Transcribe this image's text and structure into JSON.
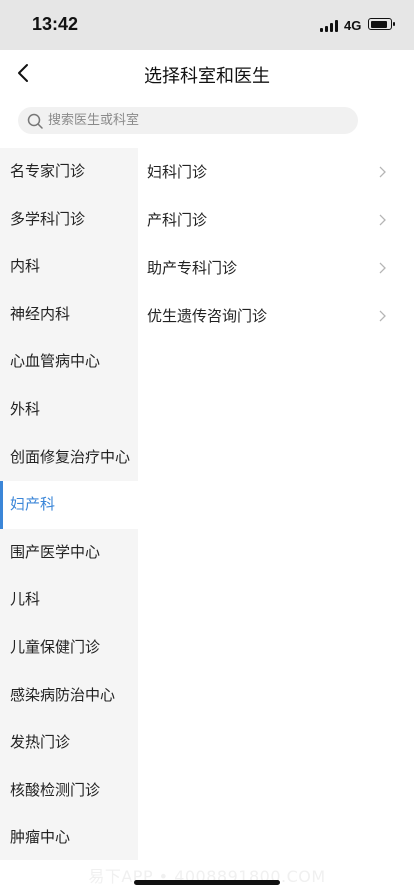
{
  "status_bar": {
    "time": "13:42",
    "network": "4G"
  },
  "header": {
    "title": "选择科室和医生"
  },
  "search": {
    "placeholder": "搜索医生或科室"
  },
  "left_menu": {
    "items": [
      {
        "label": "名专家门诊"
      },
      {
        "label": "多学科门诊"
      },
      {
        "label": "内科"
      },
      {
        "label": "神经内科"
      },
      {
        "label": "心血管病中心"
      },
      {
        "label": "外科"
      },
      {
        "label": "创面修复治疗中心"
      },
      {
        "label": "妇产科"
      },
      {
        "label": "围产医学中心"
      },
      {
        "label": "儿科"
      },
      {
        "label": "儿童保健门诊"
      },
      {
        "label": "感染病防治中心"
      },
      {
        "label": "发热门诊"
      },
      {
        "label": "核酸检测门诊"
      },
      {
        "label": "肿瘤中心"
      }
    ],
    "selected": "妇产科"
  },
  "right_menu": {
    "items": [
      {
        "label": "妇科门诊"
      },
      {
        "label": "产科门诊"
      },
      {
        "label": "助产专科门诊"
      },
      {
        "label": "优生遗传咨询门诊"
      }
    ]
  },
  "footer": {
    "watermark": "易下APP • 4008891800.COM"
  },
  "colors": {
    "accent": "#3b86d8",
    "sidebar_bg": "#f5f5f5"
  }
}
